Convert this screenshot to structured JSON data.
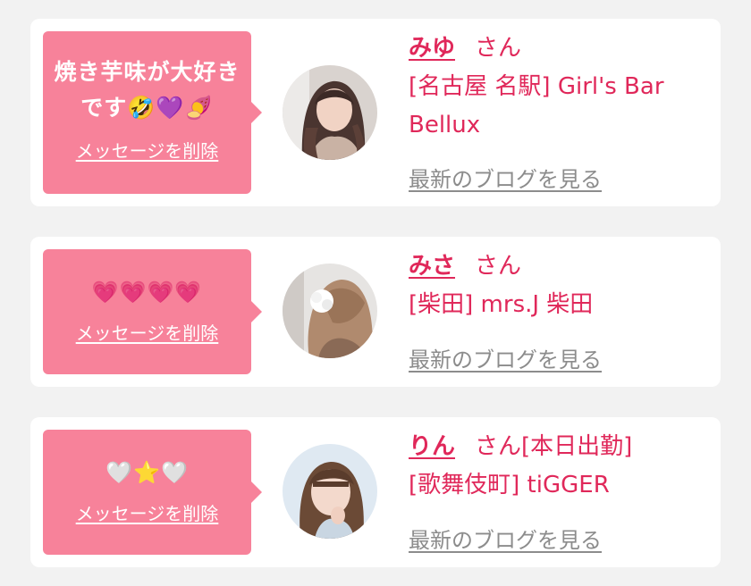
{
  "cards": [
    {
      "message": "焼き芋味が大好きです🤣💜🍠",
      "delete_label": "メッセージを削除",
      "name": "みゆ",
      "honorific": "さん",
      "shop": "[名古屋 名駅] Girl's Bar Bellux",
      "blog_label": "最新のブログを見る",
      "avatar_icon": "avatar-photo-icon"
    },
    {
      "message": "💗💗💗💗",
      "delete_label": "メッセージを削除",
      "name": "みさ",
      "honorific": "さん",
      "shop": "[柴田] mrs.J 柴田",
      "blog_label": "最新のブログを見る",
      "avatar_icon": "avatar-photo-icon"
    },
    {
      "message": "🤍⭐🤍",
      "delete_label": "メッセージを削除",
      "name": "りん",
      "honorific": "さん[本日出勤]",
      "shop": "[歌舞伎町] tiGGER",
      "blog_label": "最新のブログを見る",
      "avatar_icon": "avatar-photo-icon"
    }
  ],
  "colors": {
    "background": "#f2f2f2",
    "card": "#ffffff",
    "bubble": "#f7829a",
    "accent": "#e0285a",
    "muted_link": "#8c8c8c"
  }
}
